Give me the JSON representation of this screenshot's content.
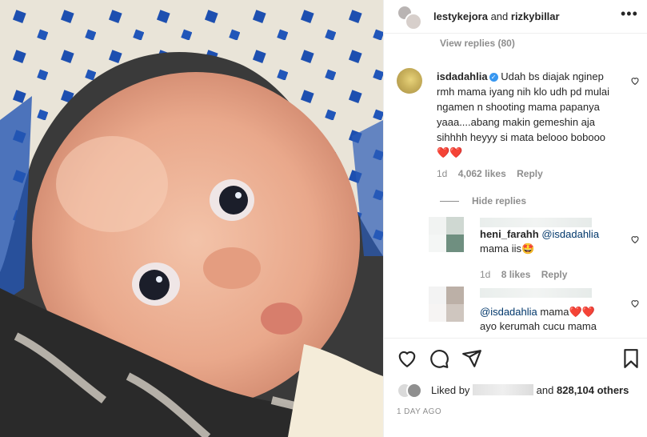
{
  "post": {
    "header": {
      "user1": "lestykejora",
      "joiner": "and",
      "user2": "rizkybillar"
    },
    "view_replies": "View replies (80)",
    "comment": {
      "username": "isdadahlia",
      "verified_badge": "✓",
      "text": "Udah bs diajak nginep rmh mama iyang nih klo udh pd mulai ngamen n shooting mama papanya yaaa....abang makin gemeshin aja sihhhh heyyy si mata belooo bobooo ❤️❤️",
      "age": "1d",
      "likes": "4,062 likes",
      "reply_label": "Reply"
    },
    "hide_replies": "Hide replies",
    "replies": [
      {
        "username": "heni_farahh",
        "mention": "@isdadahlia",
        "text": "mama iis🤩",
        "age": "1d",
        "likes": "8 likes",
        "reply_label": "Reply"
      },
      {
        "mention": "@isdadahlia",
        "text": "mama❤️❤️",
        "text2": "ayo kerumah cucu mama"
      }
    ],
    "likes_line": {
      "prefix": "Liked by",
      "suffix": "and",
      "count": "828,104 others"
    },
    "timestamp": "1 DAY AGO"
  },
  "icons": {
    "more": "more-options-icon",
    "heart": "heart-icon",
    "comment": "comment-icon",
    "share": "share-icon",
    "save": "bookmark-icon"
  }
}
